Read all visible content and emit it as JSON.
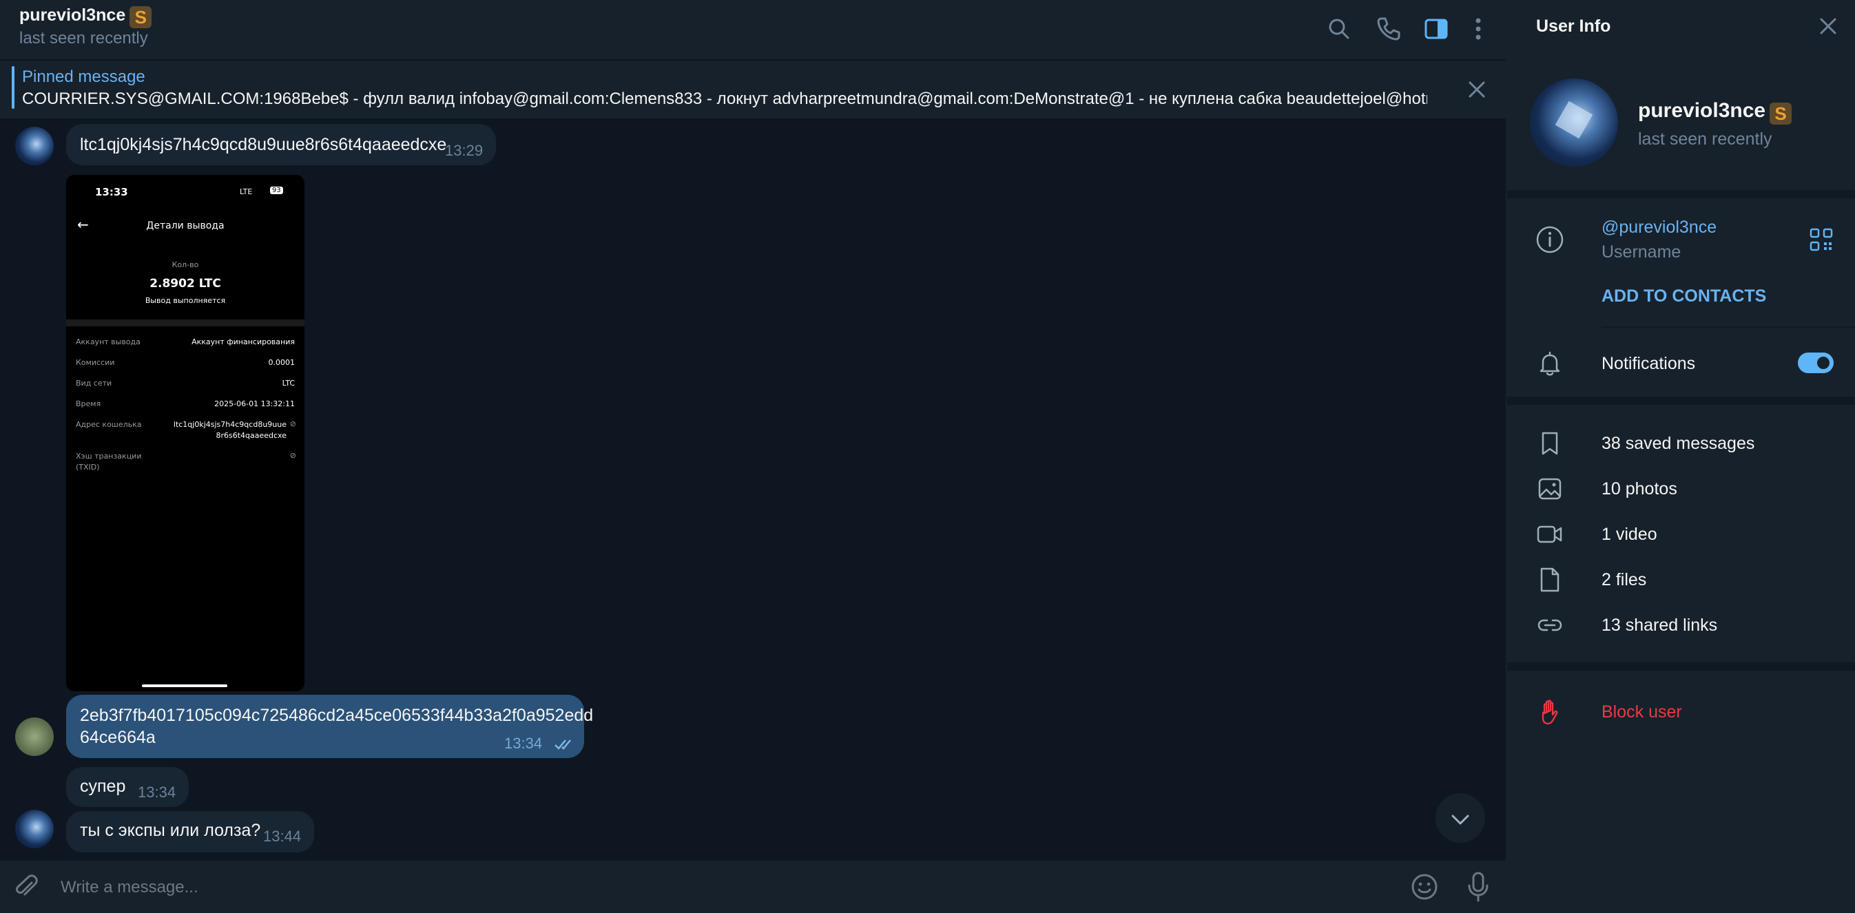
{
  "chat": {
    "title": "pureviol3nce",
    "status": "last seen recently",
    "pinned": {
      "label": "Pinned message",
      "text": "COURRIER.SYS@GMAIL.COM:1968Bebe$ - фулл валид infobay@gmail.com:Clemens833 - локнут advharpreetmundra@gmail.com:DeMonstrate@1 - не куплена сабка beaudettejoel@hotm..."
    },
    "messages": [
      {
        "text": "ltc1qj0kj4sjs7h4c9qcd8u9uue8r6s6t4qaaeedcxe",
        "time": "13:29"
      },
      {
        "text_line1": "2eb3f7fb4017105c094c725486cd2a45ce06533f44b33a2f0a952edd",
        "text_line2": "64ce664a",
        "time": "13:34"
      },
      {
        "text": "супер",
        "time": "13:34"
      },
      {
        "text": "ты с экспы или лолза?",
        "time": "13:44"
      }
    ],
    "photo": {
      "clock": "13:33",
      "network": "LTE",
      "battery": "93",
      "header": "Детали вывода",
      "qty_label": "Кол-во",
      "amount": "2.8902 LTC",
      "progress": "Вывод выполняется",
      "rows": [
        {
          "label": "Аккаунт вывода",
          "value": "Аккаунт финансирования"
        },
        {
          "label": "Комиссии",
          "value": "0.0001"
        },
        {
          "label": "Вид сети",
          "value": "LTC"
        },
        {
          "label": "Время",
          "value": "2025-06-01 13:32:11"
        }
      ],
      "addr_label": "Адрес кошелька",
      "addr_line1": "ltc1qj0kj4sjs7h4c9qcd8u9uue",
      "addr_line2": "8r6s6t4qaaeedcxe",
      "txid_label_line1": "Хэш транзакции",
      "txid_label_line2": "(TXID)"
    },
    "composer_placeholder": "Write a message..."
  },
  "panel": {
    "header": "User Info",
    "name": "pureviol3nce",
    "status": "last seen recently",
    "username": "@pureviol3nce",
    "username_label": "Username",
    "add_contacts": "ADD TO CONTACTS",
    "notifications": "Notifications",
    "notifications_on": true,
    "media": [
      {
        "icon": "bookmark-icon",
        "label": "38 saved messages"
      },
      {
        "icon": "photo-icon",
        "label": "10 photos"
      },
      {
        "icon": "video-icon",
        "label": "1 video"
      },
      {
        "icon": "file-icon",
        "label": "2 files"
      },
      {
        "icon": "link-icon",
        "label": "13 shared links"
      }
    ],
    "block": "Block user"
  },
  "colors": {
    "accent": "#6ab2f2",
    "outgoing_bubble": "#2b5278",
    "incoming_bubble": "#182533",
    "danger": "#ec3942",
    "premium_badge": "#f0a030"
  }
}
